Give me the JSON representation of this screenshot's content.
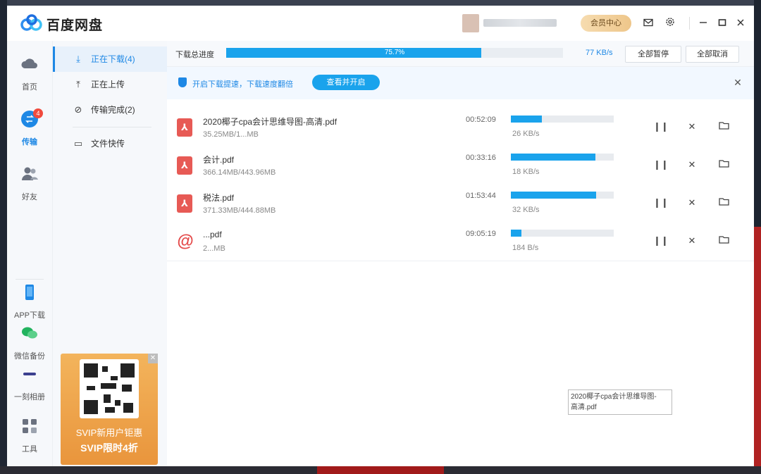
{
  "app": {
    "name": "百度网盘",
    "brand_color": "#1e88e5"
  },
  "titlebar": {
    "vip_label": "会员中心",
    "icons": [
      "mail-icon",
      "settings-icon",
      "minimize-icon",
      "maximize-icon",
      "close-icon"
    ]
  },
  "leftnav": {
    "items": [
      {
        "label": "首页",
        "icon": "cloud-home-icon"
      },
      {
        "label": "传输",
        "icon": "transfer-icon",
        "badge": "4",
        "active": true
      },
      {
        "label": "好友",
        "icon": "friends-icon"
      },
      {
        "label": "APP下载",
        "icon": "phone-icon"
      },
      {
        "label": "微信备份",
        "icon": "wechat-icon"
      },
      {
        "label": "一刻相册",
        "icon": "album-icon"
      },
      {
        "label": "工具",
        "icon": "tools-icon"
      }
    ]
  },
  "subnav": {
    "items": [
      {
        "label": "正在下载(4)",
        "icon": "download-icon",
        "active": true
      },
      {
        "label": "正在上传",
        "icon": "upload-icon"
      },
      {
        "label": "传输完成(2)",
        "icon": "check-circle-icon"
      },
      {
        "label": "文件快传",
        "icon": "monitor-icon"
      }
    ]
  },
  "ad": {
    "line1": "SVIP新用户钜惠",
    "line2": "SVIP限时4折"
  },
  "main": {
    "total_label": "下载总进度",
    "total_percent": "75.7%",
    "total_fraction": 0.757,
    "total_speed": "77 KB/s",
    "pause_all": "全部暂停",
    "cancel_all": "全部取消",
    "notice_text": "开启下载提速，下载速度翻倍",
    "notice_button": "查看并开启",
    "downloads": [
      {
        "name": "2020椰子cpa会计思维导图-高清.pdf",
        "size": "35.25MB/1...MB",
        "time": "00:52:09",
        "progress": 0.3,
        "speed": "26 KB/s",
        "type": "pdf"
      },
      {
        "name": "会计.pdf",
        "size": "366.14MB/443.96MB",
        "time": "00:33:16",
        "progress": 0.82,
        "speed": "18 KB/s",
        "type": "pdf"
      },
      {
        "name": "税法.pdf",
        "size": "371.33MB/444.88MB",
        "time": "01:53:44",
        "progress": 0.83,
        "speed": "32 KB/s",
        "type": "pdf"
      },
      {
        "name": "...pdf",
        "size": "2...MB",
        "time": "09:05:19",
        "progress": 0.1,
        "speed": "184 B/s",
        "type": "other"
      }
    ]
  },
  "tooltip": {
    "line1": "2020椰子cpa会计思维导图-",
    "line2": "高清.pdf"
  }
}
